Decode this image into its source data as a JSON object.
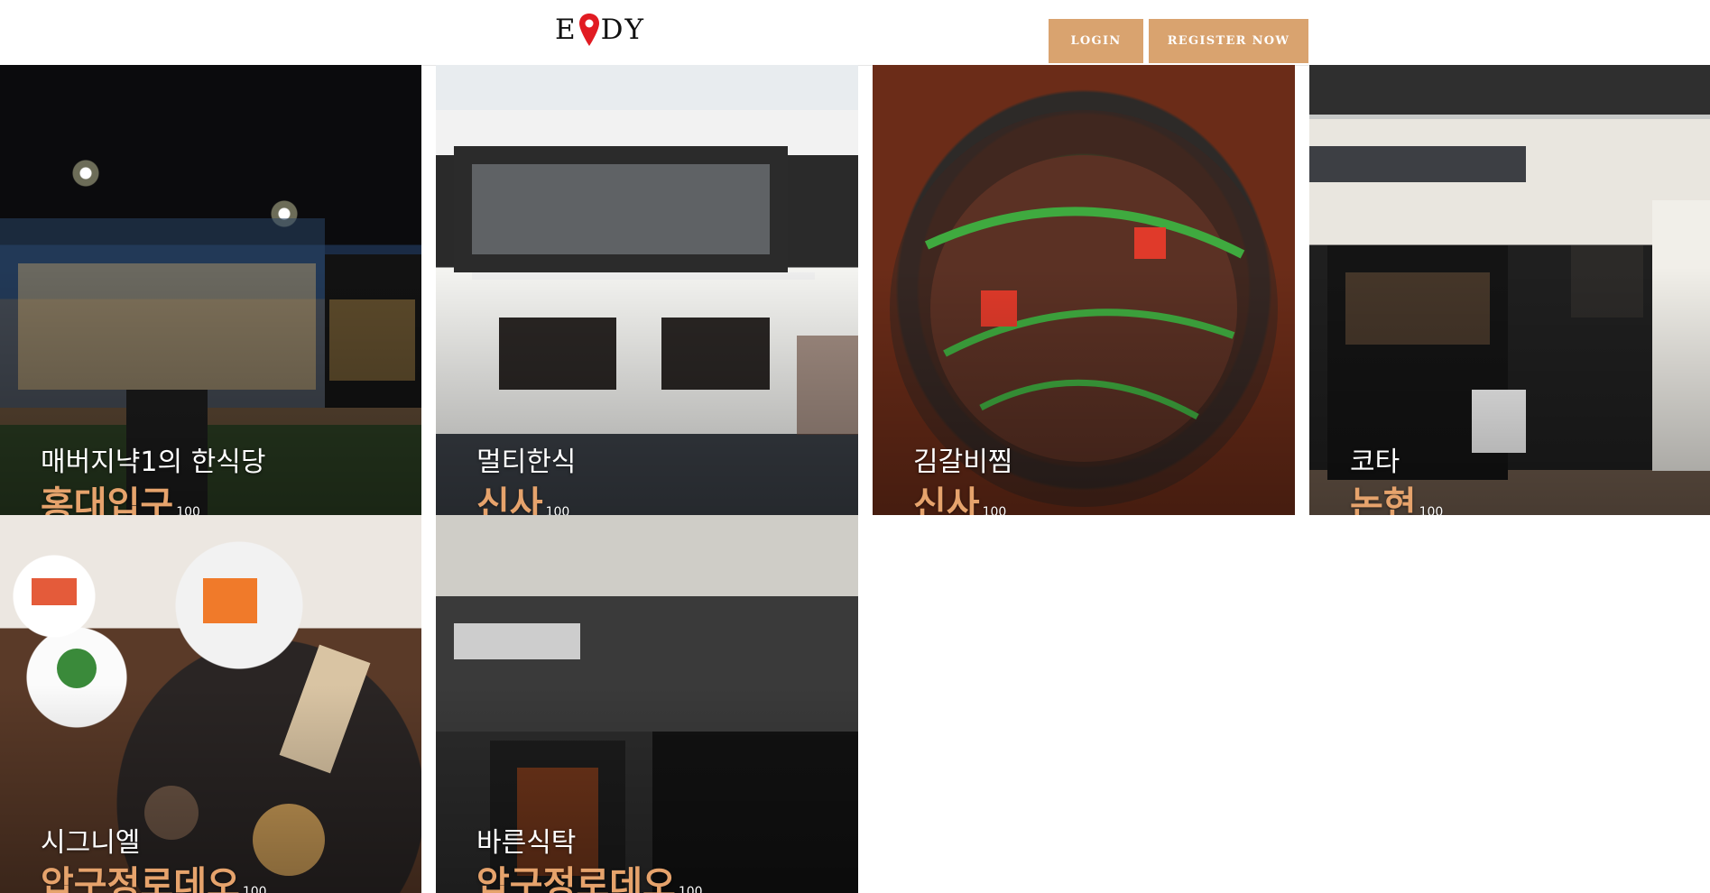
{
  "header": {
    "logo": {
      "left": "E",
      "right": "DY"
    },
    "login_label": "LOGIN",
    "register_label": "REGISTER NOW"
  },
  "restaurants": [
    {
      "name": "매버지냑1의 한식당",
      "location": "홍대입구",
      "score": "100"
    },
    {
      "name": "멀티한식",
      "location": "신사",
      "score": "100"
    },
    {
      "name": "김갈비찜",
      "location": "신사",
      "score": "100"
    },
    {
      "name": "코타",
      "location": "논현",
      "score": "100"
    },
    {
      "name": "시그니엘",
      "location": "압구정로데오",
      "score": "100"
    },
    {
      "name": "바른식탁",
      "location": "압구정로데오",
      "score": "100"
    }
  ],
  "colors": {
    "accent": "#d9a36f",
    "location_text": "#e6a36c"
  }
}
